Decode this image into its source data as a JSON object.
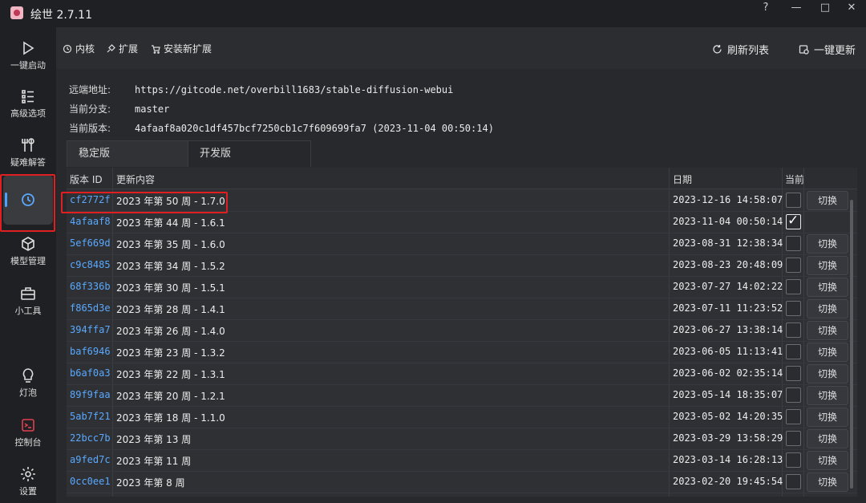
{
  "window": {
    "title": "绘世 2.7.11",
    "help": "?",
    "minimize": "—",
    "maximize": "□",
    "close": "✕"
  },
  "sidebar": {
    "items": [
      {
        "label": "一键启动",
        "icon": "play-icon"
      },
      {
        "label": "高级选项",
        "icon": "list-icon"
      },
      {
        "label": "疑难解答",
        "icon": "tools-icon"
      },
      {
        "label": "",
        "icon": "history-icon",
        "active": true
      },
      {
        "label": "模型管理",
        "icon": "cube-icon"
      },
      {
        "label": "小工具",
        "icon": "toolbox-icon"
      },
      {
        "label": "灯泡",
        "icon": "bulb-icon"
      },
      {
        "label": "控制台",
        "icon": "console-icon"
      },
      {
        "label": "设置",
        "icon": "gear-icon"
      }
    ]
  },
  "toolbar": {
    "kernel": "内核",
    "extensions": "扩展",
    "install_ext": "安装新扩展",
    "refresh": "刷新列表",
    "update_all": "一键更新"
  },
  "info": {
    "remote_label": "远端地址:",
    "remote_value": "https://gitcode.net/overbill1683/stable-diffusion-webui",
    "branch_label": "当前分支:",
    "branch_value": "master",
    "version_label": "当前版本:",
    "version_value": "4afaaf8a020c1df457bcf7250cb1c7f609699fa7 (2023-11-04 00:50:14)"
  },
  "tabs": {
    "stable": "稳定版",
    "dev": "开发版"
  },
  "table": {
    "headers": {
      "id": "版本 ID",
      "desc": "更新内容",
      "date": "日期",
      "current": "当前"
    },
    "switch_label": "切换",
    "rows": [
      {
        "id": "cf2772f",
        "desc": "2023 年第 50 周 - 1.7.0",
        "date": "2023-12-16 14:58:07",
        "current": false
      },
      {
        "id": "4afaaf8",
        "desc": "2023 年第 44 周 - 1.6.1",
        "date": "2023-11-04 00:50:14",
        "current": true
      },
      {
        "id": "5ef669d",
        "desc": "2023 年第 35 周 - 1.6.0",
        "date": "2023-08-31 12:38:34",
        "current": false
      },
      {
        "id": "c9c8485",
        "desc": "2023 年第 34 周 - 1.5.2",
        "date": "2023-08-23 20:48:09",
        "current": false
      },
      {
        "id": "68f336b",
        "desc": "2023 年第 30 周 - 1.5.1",
        "date": "2023-07-27 14:02:22",
        "current": false
      },
      {
        "id": "f865d3e",
        "desc": "2023 年第 28 周 - 1.4.1",
        "date": "2023-07-11 11:23:52",
        "current": false
      },
      {
        "id": "394ffa7",
        "desc": "2023 年第 26 周 - 1.4.0",
        "date": "2023-06-27 13:38:14",
        "current": false
      },
      {
        "id": "baf6946",
        "desc": "2023 年第 23 周 - 1.3.2",
        "date": "2023-06-05 11:13:41",
        "current": false
      },
      {
        "id": "b6af0a3",
        "desc": "2023 年第 22 周 - 1.3.1",
        "date": "2023-06-02 02:35:14",
        "current": false
      },
      {
        "id": "89f9faa",
        "desc": "2023 年第 20 周 - 1.2.1",
        "date": "2023-05-14 18:35:07",
        "current": false
      },
      {
        "id": "5ab7f21",
        "desc": "2023 年第 18 周 - 1.1.0",
        "date": "2023-05-02 14:20:35",
        "current": false
      },
      {
        "id": "22bcc7b",
        "desc": "2023 年第 13 周",
        "date": "2023-03-29 13:58:29",
        "current": false
      },
      {
        "id": "a9fed7c",
        "desc": "2023 年第 11 周",
        "date": "2023-03-14 16:28:13",
        "current": false
      },
      {
        "id": "0cc0ee1",
        "desc": "2023 年第 8 周",
        "date": "2023-02-20 19:45:54",
        "current": false
      }
    ]
  }
}
